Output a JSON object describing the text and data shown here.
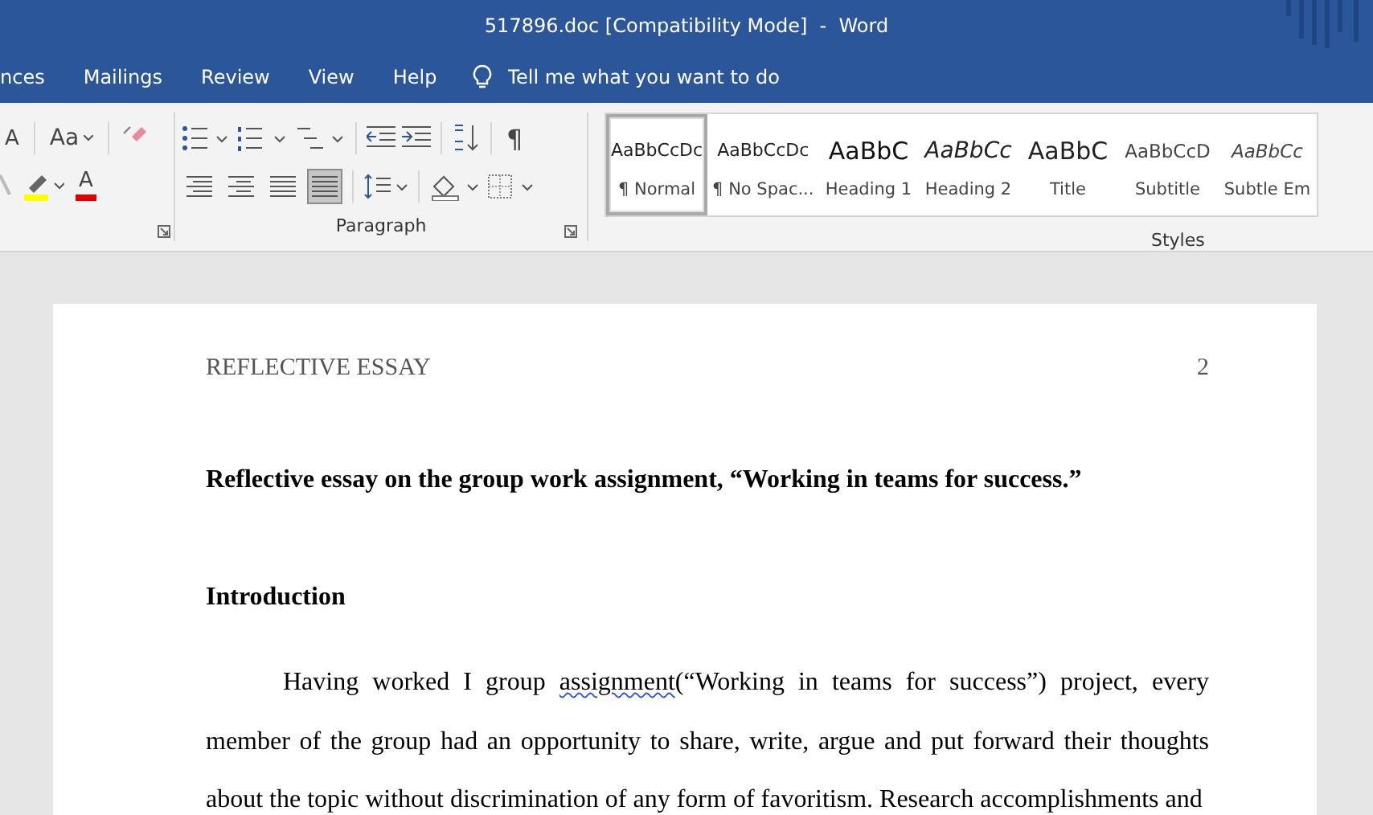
{
  "window": {
    "title": "517896.doc [Compatibility Mode]  -  Word"
  },
  "tabs": [
    {
      "label": "nces",
      "selected": false
    },
    {
      "label": "Mailings",
      "selected": false
    },
    {
      "label": "Review",
      "selected": false
    },
    {
      "label": "View",
      "selected": false
    },
    {
      "label": "Help",
      "selected": false
    }
  ],
  "tell_me": {
    "placeholder": "Tell me what you want to do"
  },
  "font_group": {
    "case_button": "Aa",
    "grow_button": "A",
    "color_button": "A"
  },
  "paragraph_group": {
    "label": "Paragraph",
    "show_marks": "¶",
    "justify_selected": true
  },
  "styles": {
    "label": "Styles",
    "items": [
      {
        "preview": "AaBbCcDc",
        "name": "¶ Normal",
        "kind": "normal",
        "selected": true
      },
      {
        "preview": "AaBbCcDc",
        "name": "¶ No Spac...",
        "kind": "normal",
        "selected": false
      },
      {
        "preview": "AaBbC",
        "name": "Heading 1",
        "kind": "heading1",
        "selected": false
      },
      {
        "preview": "AaBbCc",
        "name": "Heading 2",
        "kind": "heading2",
        "selected": false
      },
      {
        "preview": "AaBbC",
        "name": "Title",
        "kind": "title",
        "selected": false
      },
      {
        "preview": "AaBbCcD",
        "name": "Subtitle",
        "kind": "subtitle",
        "selected": false
      },
      {
        "preview": "AaBbCc",
        "name": "Subtle Em",
        "kind": "subtle",
        "selected": false
      }
    ]
  },
  "document": {
    "header": "REFLECTIVE ESSAY",
    "page_number": "2",
    "blocks": [
      {
        "kind": "heading",
        "text": "Reflective essay on the group work assignment, “Working in teams for success.”"
      },
      {
        "kind": "heading",
        "text": "Introduction"
      },
      {
        "kind": "paragraph",
        "segments": [
          {
            "text": "Having worked I group ",
            "misspelled": false
          },
          {
            "text": "assignment",
            "misspelled": true
          },
          {
            "text": "(“Working in teams for success”) project, every member of the group had an opportunity to share, write, argue and put forward their thoughts about the topic without discrimination of any form of favoritism. Research accomplishments and",
            "misspelled": false
          }
        ]
      }
    ]
  }
}
